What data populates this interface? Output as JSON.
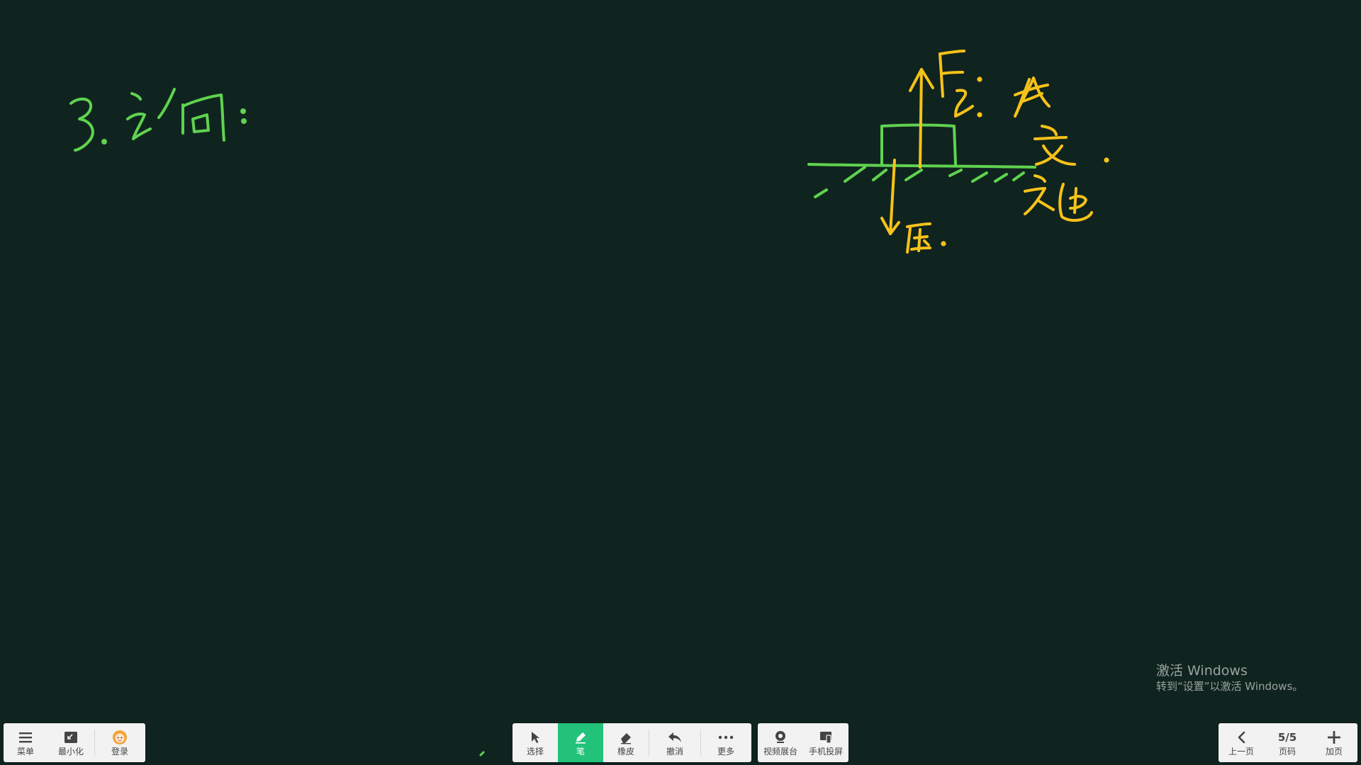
{
  "board": {
    "heading_text": "3. 论：",
    "diagram": {
      "force_up_label": "F支",
      "force_down_label": "F压",
      "side_labels": [
        "作",
        "受",
        "施"
      ]
    },
    "ink_colors": {
      "green": "#5fd34f",
      "yellow": "#f6c21a"
    },
    "background_color": "#10241f"
  },
  "toolbar_left": {
    "menu": {
      "label": "菜单",
      "icon": "hamburger-icon"
    },
    "minimize": {
      "label": "最小化",
      "icon": "minimize-icon"
    },
    "login": {
      "label": "登录",
      "icon": "avatar-icon"
    }
  },
  "toolbar_center": {
    "select": {
      "label": "选择",
      "icon": "cursor-icon"
    },
    "pen": {
      "label": "笔",
      "icon": "pen-icon",
      "active": true
    },
    "eraser": {
      "label": "橡皮",
      "icon": "eraser-icon"
    },
    "undo": {
      "label": "撤消",
      "icon": "undo-icon"
    },
    "more": {
      "label": "更多",
      "icon": "more-icon"
    },
    "accent_color": "#22c27a"
  },
  "toolbar_media": {
    "camera": {
      "label": "视频展台",
      "icon": "camera-icon"
    },
    "phone_cast": {
      "label": "手机投屏",
      "icon": "phone-cast-icon"
    }
  },
  "toolbar_right": {
    "prev": {
      "label": "上一页",
      "icon": "chevron-left-icon"
    },
    "page": {
      "value": "5/5",
      "label": "页码"
    },
    "add": {
      "label": "加页",
      "icon": "plus-icon"
    }
  },
  "watermark": {
    "line1": "激活 Windows",
    "line2": "转到“设置”以激活 Windows。"
  }
}
